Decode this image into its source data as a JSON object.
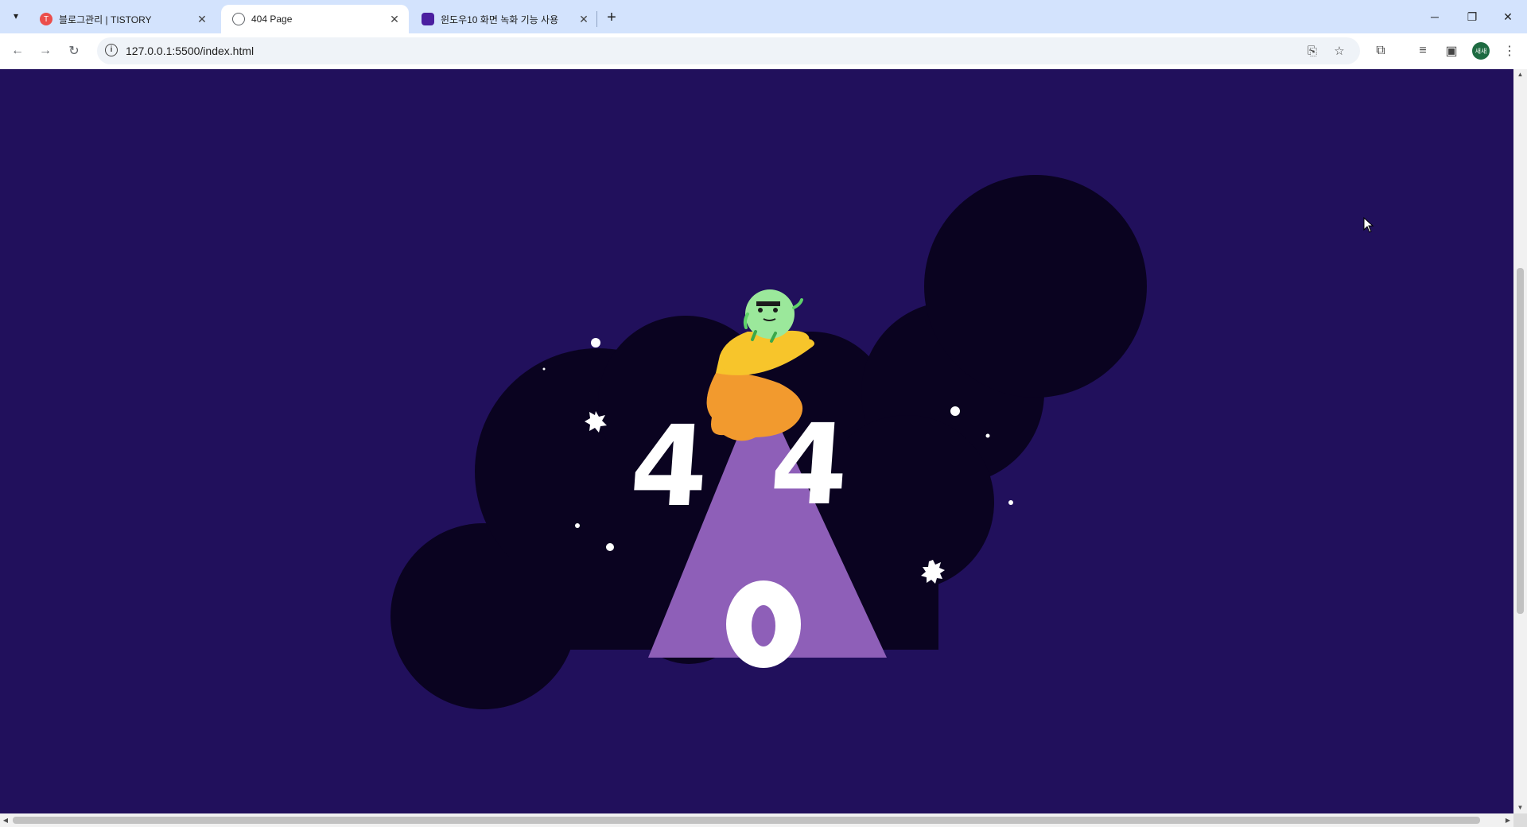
{
  "browser": {
    "tabs": [
      {
        "title": "블로그관리 | TISTORY",
        "favicon": "tistory-favicon",
        "favicon_color": "#eb4d4b",
        "favicon_glyph": "T",
        "active": false
      },
      {
        "title": "404 Page",
        "favicon": "globe-favicon",
        "favicon_color": "#5f6368",
        "favicon_glyph": "",
        "active": true
      },
      {
        "title": "윈도우10 화면 녹화 기능 사용",
        "favicon": "purple-app-favicon",
        "favicon_color": "#4b1fa0",
        "favicon_glyph": "",
        "active": false
      }
    ],
    "url": "127.0.0.1:5500/index.html",
    "profile_initials": "새새"
  },
  "page": {
    "background_color": "#21105c",
    "cloud_color": "#0a0320",
    "beam_color": "#8e5fb8",
    "digits": [
      "4",
      "0",
      "4"
    ],
    "alien_color": "#9be89b",
    "ufo_top_color": "#f7c52b",
    "ufo_bottom_color": "#f29a2e"
  }
}
